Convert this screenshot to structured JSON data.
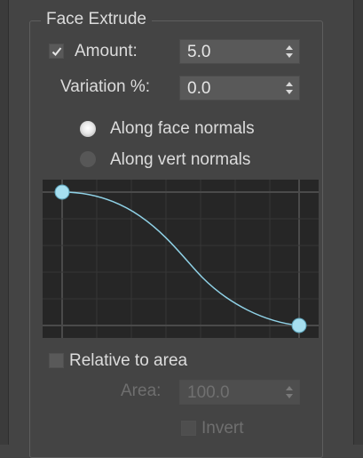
{
  "group": {
    "title": "Face Extrude"
  },
  "amount": {
    "label": "Amount:",
    "value": "5.0",
    "checked": true
  },
  "variation": {
    "label": "Variation %:",
    "value": "0.0"
  },
  "normals": {
    "options": [
      {
        "label": "Along face normals",
        "selected": true
      },
      {
        "label": "Along vert normals",
        "selected": false
      }
    ]
  },
  "curve": {
    "line_color": "#8fd1e6",
    "point_color": "#a6dff0"
  },
  "relative": {
    "label": "Relative to area",
    "checked": false
  },
  "area": {
    "label": "Area:",
    "value": "100.0",
    "enabled": false
  },
  "invert": {
    "label": "Invert",
    "checked": false,
    "enabled": false
  }
}
